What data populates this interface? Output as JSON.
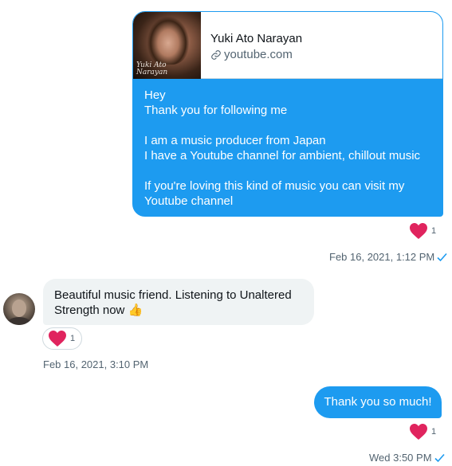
{
  "link_card": {
    "thumbnail_signature": "Yuki Ato\nNarayan",
    "title": "Yuki Ato Narayan",
    "domain": "youtube.com"
  },
  "messages": [
    {
      "direction": "outgoing",
      "text": "Hey\nThank you for following me\n\nI am a music producer from Japan\nI have a Youtube channel for ambient, chillout music\n\nIf you're loving this kind of music you can visit  my\nYoutube channel",
      "reaction_count": "1",
      "timestamp": "Feb 16, 2021, 1:12 PM"
    },
    {
      "direction": "incoming",
      "text": "Beautiful music friend. Listening to Unaltered Strength now 👍",
      "reaction_count": "1",
      "timestamp": "Feb 16, 2021, 3:10 PM"
    },
    {
      "direction": "outgoing",
      "text": "Thank you so much!",
      "reaction_count": "1",
      "timestamp": "Wed 3:50 PM"
    }
  ],
  "colors": {
    "accent": "#1d9bf0",
    "heart": "#e0245e",
    "incoming_bubble": "#eff3f4",
    "muted_text": "#536471"
  },
  "icons": {
    "link": "link-icon",
    "reaction": "heart-icon",
    "sent_status": "checkmark-icon"
  }
}
